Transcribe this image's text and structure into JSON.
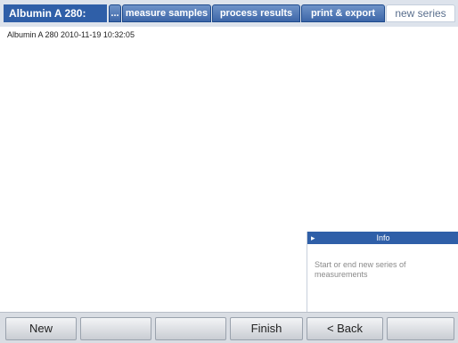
{
  "header": {
    "app_title": "Albumin A 280:",
    "tabs": [
      {
        "label": "...",
        "active": false
      },
      {
        "label": "measure samples",
        "active": false
      },
      {
        "label": "process results",
        "active": false
      },
      {
        "label": "print & export",
        "active": false
      },
      {
        "label": "new series",
        "active": true
      }
    ]
  },
  "main": {
    "series_entry": "Albumin A 280 2010-11-19 10:32:05"
  },
  "info": {
    "arrow": "▸",
    "title": "Info",
    "text": "Start or end new series of measurements"
  },
  "footer": {
    "buttons": [
      "New",
      "",
      "",
      "Finish",
      "< Back",
      ""
    ]
  },
  "colors": {
    "accent": "#2f5fa8",
    "tab_gradient_top": "#6f93c8",
    "footer_bg": "#d9dde3"
  }
}
